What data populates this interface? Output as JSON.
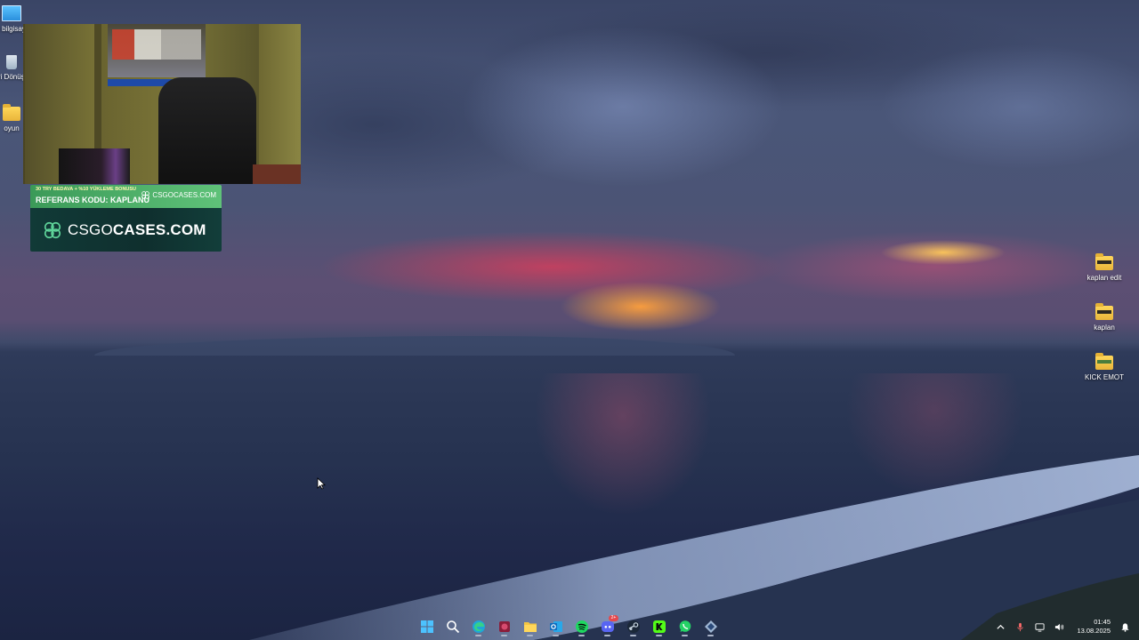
{
  "desktop": {
    "left_icons": [
      {
        "label": "Bu bilgisayar",
        "icon": "this-pc-icon"
      },
      {
        "label": "Geri Dönüşüm",
        "icon": "recycle-bin-icon"
      },
      {
        "label": "oyun",
        "icon": "folder-icon"
      }
    ],
    "right_icons": [
      {
        "label": "kaplan edit",
        "icon": "folder-icon"
      },
      {
        "label": "kaplan",
        "icon": "folder-icon"
      },
      {
        "label": "KICK EMOT",
        "icon": "folder-icon"
      }
    ]
  },
  "promo": {
    "line1": "30 TRY BEDAVA + %10 YÜKLEME BONUSU",
    "line2": "REFERANS KODU: KAPLANU",
    "brand_small": "CSGOCASES.COM",
    "brand_big_left": "CSGO",
    "brand_big_right": "CASES.COM"
  },
  "taskbar": {
    "apps": [
      {
        "name": "start",
        "icon": "windows-start-icon"
      },
      {
        "name": "search",
        "icon": "search-icon"
      },
      {
        "name": "edge",
        "icon": "edge-icon"
      },
      {
        "name": "game",
        "icon": "game-app-icon"
      },
      {
        "name": "file-explorer",
        "icon": "folder-icon"
      },
      {
        "name": "outlook",
        "icon": "outlook-icon"
      },
      {
        "name": "spotify",
        "icon": "spotify-icon"
      },
      {
        "name": "discord",
        "icon": "discord-icon",
        "badge": "2+"
      },
      {
        "name": "steam",
        "icon": "steam-icon"
      },
      {
        "name": "kick",
        "icon": "kick-icon"
      },
      {
        "name": "whatsapp",
        "icon": "whatsapp-icon"
      },
      {
        "name": "app",
        "icon": "app-icon"
      }
    ],
    "clock": {
      "time": "01:45",
      "date": "13.08.2025"
    }
  },
  "colors": {
    "spotify": "#1ed760",
    "discord": "#5865f2",
    "whatsapp": "#25d366",
    "edge": "#1fa5d8",
    "promo_green": "#4caf6a",
    "promo_dark": "#103836"
  }
}
